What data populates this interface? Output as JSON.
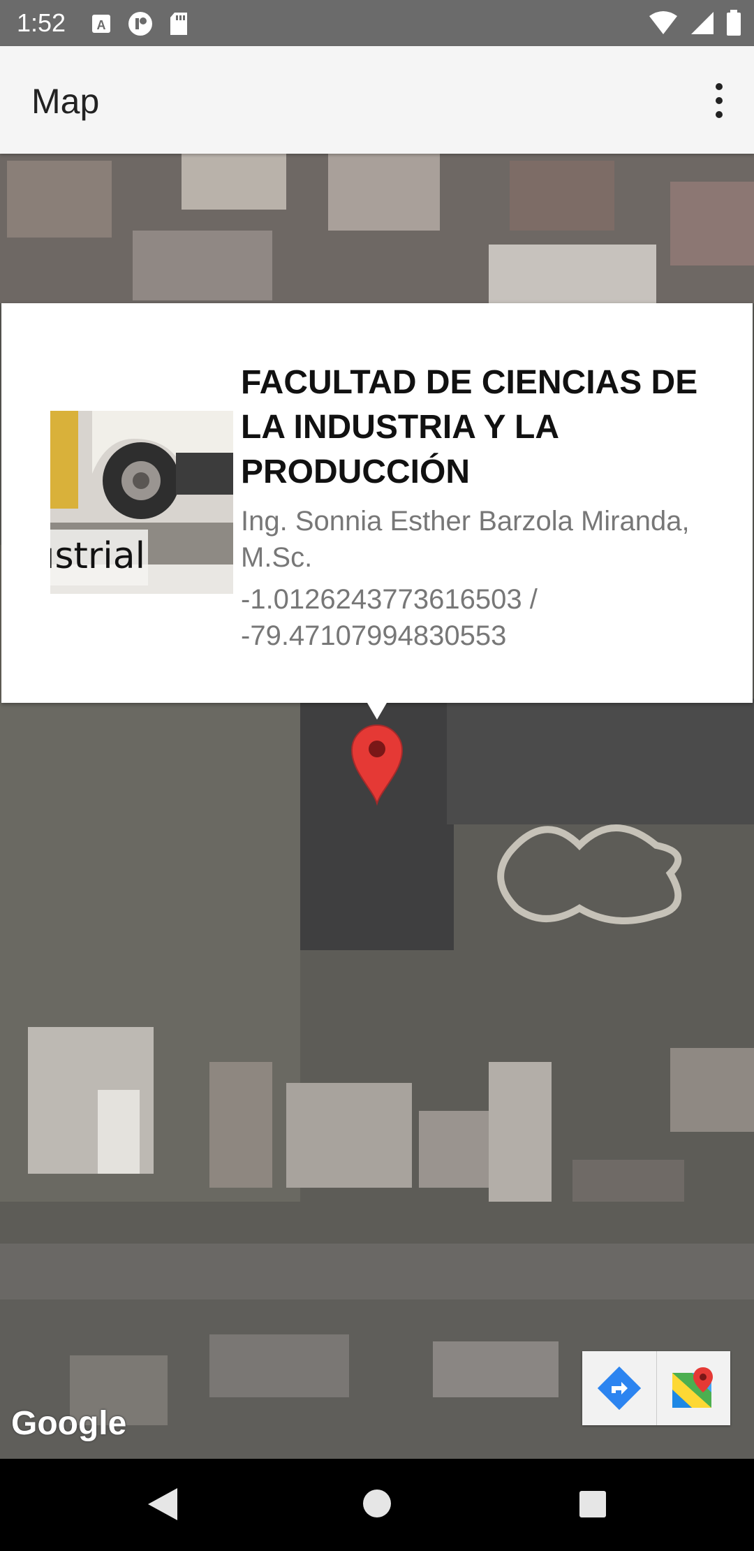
{
  "status_bar": {
    "time": "1:52",
    "icons_left": [
      "a-icon",
      "play-icon",
      "sd-card-icon"
    ],
    "icons_right": [
      "wifi-icon",
      "signal-icon",
      "battery-icon"
    ]
  },
  "app_bar": {
    "title": "Map",
    "overflow_icon": "more-vert-icon"
  },
  "info_window": {
    "thumbnail_caption": "ıstrial",
    "title": "FACULTAD DE CIENCIAS DE LA INDUSTRIA Y LA PRODUCCIÓN",
    "subtitle": "Ing. Sonnia Esther Barzola Miranda, M.Sc.",
    "coordinates": "-1.0126243773616503 / -79.47107994830553"
  },
  "map": {
    "logo": "Google",
    "toolbar": [
      "directions-icon",
      "google-maps-icon"
    ],
    "marker_color": "#e53935"
  },
  "nav_bar": {
    "buttons": [
      "back-icon",
      "home-icon",
      "recents-icon"
    ]
  }
}
